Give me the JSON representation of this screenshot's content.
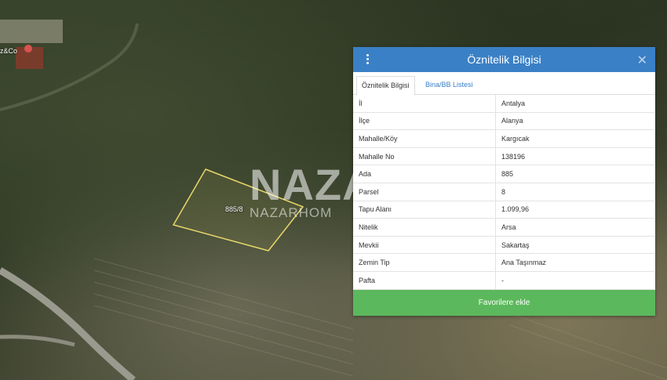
{
  "map": {
    "poi_label": "z&Co",
    "parcel_label": "885/8",
    "watermark": "NAZA",
    "watermark_sub": "NAZARHOM"
  },
  "panel": {
    "title": "Öznitelik Bilgisi",
    "tabs": [
      {
        "label": "Öznitelik Bilgisi",
        "active": true
      },
      {
        "label": "Bina/BB Listesi",
        "active": false
      }
    ],
    "rows": [
      {
        "key": "İl",
        "value": "Antalya"
      },
      {
        "key": "İlçe",
        "value": "Alanya"
      },
      {
        "key": "Mahalle/Köy",
        "value": "Kargıcak"
      },
      {
        "key": "Mahalle No",
        "value": "138196"
      },
      {
        "key": "Ada",
        "value": "885"
      },
      {
        "key": "Parsel",
        "value": "8"
      },
      {
        "key": "Tapu Alanı",
        "value": "1.099,96"
      },
      {
        "key": "Nitelik",
        "value": "Arsa"
      },
      {
        "key": "Mevkii",
        "value": "Sakartaş"
      },
      {
        "key": "Zemin Tip",
        "value": "Ana Taşınmaz"
      },
      {
        "key": "Pafta",
        "value": "-"
      }
    ],
    "favorite_button": "Favorilere ekle",
    "close_symbol": "✕"
  },
  "colors": {
    "header": "#3a80c6",
    "button": "#5cb85c",
    "parcel_outline": "#e8d86a"
  }
}
